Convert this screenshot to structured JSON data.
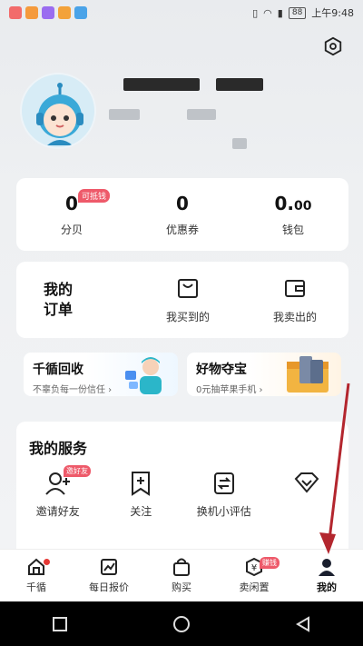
{
  "status_bar": {
    "time": "上午9:48",
    "battery": "88"
  },
  "stats": [
    {
      "value": "0",
      "label": "分贝",
      "badge": "可抵钱"
    },
    {
      "value": "0",
      "label": "优惠券"
    },
    {
      "value_main": "0.",
      "value_small": "00",
      "label": "钱包"
    }
  ],
  "orders": {
    "title": "我的订单",
    "items": [
      {
        "label": "我买到的"
      },
      {
        "label": "我卖出的"
      }
    ]
  },
  "promos": [
    {
      "title": "千循回收",
      "subtitle": "不辜负每一份信任 ›"
    },
    {
      "title": "好物夺宝",
      "subtitle": "0元抽苹果手机 ›"
    }
  ],
  "services": {
    "title": "我的服务",
    "items": [
      {
        "label": "邀请好友",
        "badge": "邀好友",
        "icon": "add-user-icon"
      },
      {
        "label": "关注",
        "icon": "bookmark-plus-icon"
      },
      {
        "label": "换机小评估",
        "icon": "exchange-icon"
      },
      {
        "label": "",
        "icon": "diamond-icon"
      }
    ]
  },
  "tabbar": {
    "items": [
      {
        "label": "千循",
        "icon": "home-icon"
      },
      {
        "label": "每日报价",
        "icon": "chart-icon"
      },
      {
        "label": "购买",
        "icon": "bag-icon"
      },
      {
        "label": "卖闲置",
        "icon": "sell-icon",
        "badge": "赚钱"
      },
      {
        "label": "我的",
        "icon": "profile-icon",
        "active": true
      }
    ]
  },
  "colors": {
    "accent": "#ee5a6a",
    "annotation_arrow": "#b3262e"
  }
}
